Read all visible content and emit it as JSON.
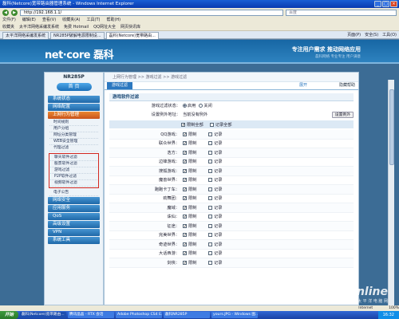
{
  "window": {
    "title": "磊科(Netcore)宽带路由器管理系统 - Windows Internet Explorer"
  },
  "address": {
    "url": "http://192.168.1.1/",
    "search_placeholder": "百度"
  },
  "menu": [
    "文件(F)",
    "编辑(E)",
    "查看(V)",
    "收藏夹(A)",
    "工具(T)",
    "帮助(H)"
  ],
  "favorites": [
    "收藏夹",
    "太平洋网络采编发系统",
    "免费 Hotmail",
    "QQ网址大全",
    "网页快讯库"
  ],
  "tabs": [
    "太平洋网络采编发系统",
    "NR285P破解电源限制设...",
    "磊科(Netcore)宽带路由..."
  ],
  "tools": [
    "页面(P)",
    "安全(S)",
    "工具(O)"
  ],
  "header": {
    "logo": "net·core 磊科",
    "slogan": "专注用户需求  推动网络应用",
    "slogan_sub": "磊科网络  专业专注 用户满意"
  },
  "sidebar": {
    "model": "NR285P",
    "home": "首  页",
    "sections_top": [
      "系统状态",
      "网络配置",
      "上网行为管理"
    ],
    "subs_top": [
      "时间规则",
      "用户分组",
      "网址分类管理",
      "WEB安全管理",
      "代理过滤"
    ],
    "subs_boxed": [
      "聊天软件过滤",
      "股票软件过滤",
      "游戏过滤",
      "P2P软件过滤",
      "视频软件过滤"
    ],
    "subs_bottom": [
      "电子公告"
    ],
    "sections_bottom": [
      "网络安全",
      "应用服务",
      "QoS",
      "高级设置",
      "VPN",
      "系统工具"
    ]
  },
  "main": {
    "breadcrumb": "上网行为管理  >>  游戏过滤  >>  游戏过滤",
    "tab": "游戏过滤",
    "open_link": "展开",
    "help": "隐藏帮助",
    "panel_title": "游戏软件过滤",
    "filter_label": "游戏过滤状态：",
    "on_label": "启用",
    "off_label": "关闭",
    "exempt_label": "设置例外地址：",
    "exempt_value": "当前没有例外",
    "exempt_button": "设置例外",
    "all_block": "限制全部",
    "all_log": "记录全部",
    "block_label": "限制",
    "log_label": "记录"
  },
  "games": [
    "QQ游戏：",
    "联众世界：",
    "浩方：",
    "边锋游戏：",
    "搜狐游戏：",
    "魔兽世界：",
    "跑跑卡丁车：",
    "劲舞团：",
    "魔域：",
    "诛仙：",
    "征途：",
    "完美世界：",
    "奇迹世界：",
    "大话西游：",
    "剑侠："
  ],
  "watermark": {
    "text": "PConline",
    "sub": "太 平 洋 电 脑 网"
  },
  "statusbar": {
    "zone": "Internet",
    "zoom": "100%"
  },
  "taskbar": {
    "start": "开始",
    "tasks": [
      "磊科(Netcore)宽带路由...",
      "腾讯晶晶 - RTX 会话",
      "Adobe Photoshop CS4 E...",
      "磊科NR285P",
      "yours.JPG - Windows 图..."
    ],
    "clock": "16:32"
  }
}
